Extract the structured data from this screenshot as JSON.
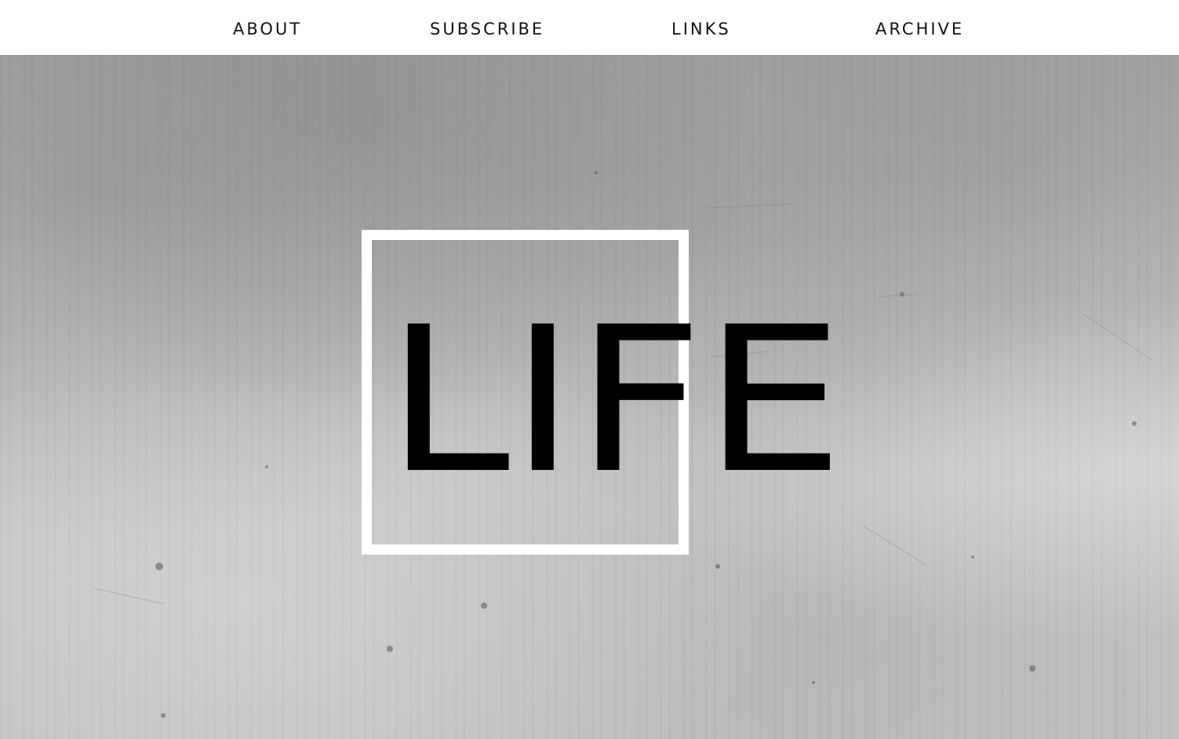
{
  "nav": {
    "items": [
      {
        "label": "ABOUT"
      },
      {
        "label": "SUBSCRIBE"
      },
      {
        "label": "LINKS"
      },
      {
        "label": "ARCHIVE"
      }
    ]
  },
  "hero": {
    "title": "LIFE",
    "background": "concrete-texture",
    "frame_color": "#ffffff",
    "title_color": "#000000"
  }
}
